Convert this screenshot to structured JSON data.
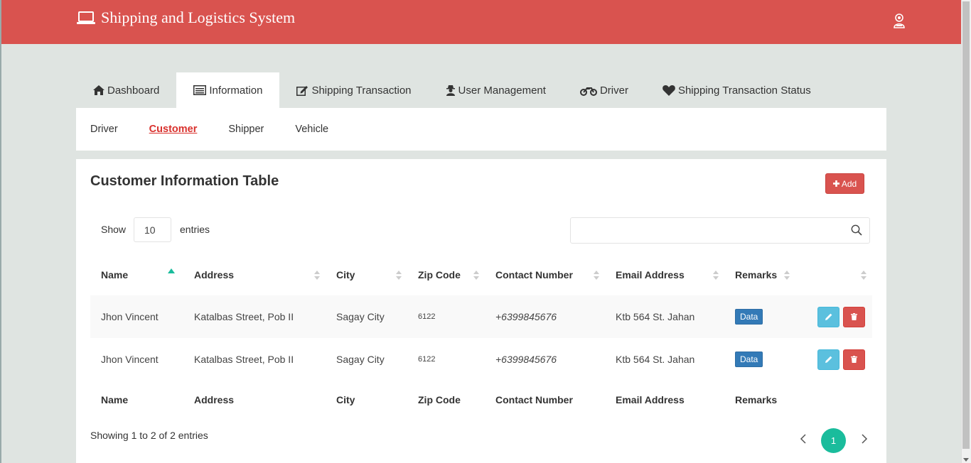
{
  "header": {
    "title": "Shipping and Logistics System",
    "brand_color": "#d9534f"
  },
  "tabs": [
    {
      "label": "Dashboard",
      "icon": "home-icon"
    },
    {
      "label": "Information",
      "icon": "list-icon",
      "active": true
    },
    {
      "label": "Shipping Transaction",
      "icon": "edit-icon"
    },
    {
      "label": "User Management",
      "icon": "user-secret-icon"
    },
    {
      "label": "Driver",
      "icon": "motorcycle-icon"
    },
    {
      "label": "Shipping Transaction Status",
      "icon": "heart-icon"
    }
  ],
  "subnav": {
    "items": [
      "Driver",
      "Customer",
      "Shipper",
      "Vehicle"
    ],
    "active": "Customer"
  },
  "card": {
    "title": "Customer Information Table",
    "add_label": "Add"
  },
  "length_control": {
    "show_label": "Show",
    "value": "10",
    "entries_label": "entries"
  },
  "search": {
    "value": ""
  },
  "table": {
    "columns": [
      "Name",
      "Address",
      "City",
      "Zip Code",
      "Contact Number",
      "Email Address",
      "Remarks",
      ""
    ],
    "rows": [
      {
        "name": "Jhon Vincent",
        "address": "Katalbas Street, Pob II",
        "city": "Sagay City",
        "zip": "6122",
        "contact": "+6399845676",
        "email": "Ktb 564 St. Jahan",
        "remarks": "Data"
      },
      {
        "name": "Jhon Vincent",
        "address": "Katalbas Street, Pob II",
        "city": "Sagay City",
        "zip": "6122",
        "contact": "+6399845676",
        "email": "Ktb 564 St. Jahan",
        "remarks": "Data"
      }
    ]
  },
  "footer": {
    "info": "Showing 1 to 2 of 2 entries",
    "current_page": "1"
  },
  "colors": {
    "accent": "#1abc9c",
    "danger": "#d9534f",
    "info": "#5bc0de",
    "primary": "#337ab7"
  }
}
